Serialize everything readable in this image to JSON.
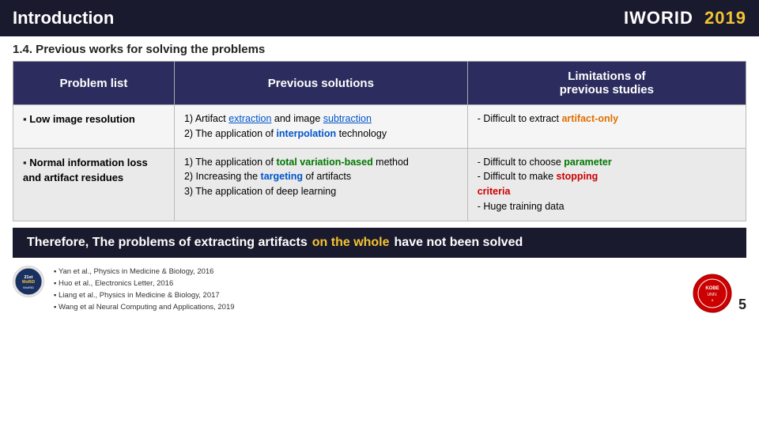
{
  "header": {
    "title": "Introduction",
    "logo_iworid": "IWORID",
    "logo_year": "2019"
  },
  "subtitle": "1.4. Previous works for solving the problems",
  "table": {
    "columns": [
      "Problem list",
      "Previous solutions",
      "Limitations of previous studies"
    ],
    "rows": [
      {
        "problem": "Low image resolution",
        "solutions": [
          {
            "num": "1)",
            "text_before": "Artifact ",
            "highlight": "extraction",
            "highlight_class": "underline-blue",
            "text_after": " and image "
          },
          {
            "continuation": "subtraction",
            "continuation_class": "underline-blue"
          },
          {
            "num": "2)",
            "text_before": "The application of ",
            "highlight": "interpolation",
            "highlight_class": "highlight-blue",
            "text_after": ""
          },
          {
            "continuation": "technology",
            "continuation_class": ""
          }
        ],
        "limitations": [
          {
            "text_before": "- Difficult to extract ",
            "highlight": "artifact-only",
            "highlight_class": "highlight-orange",
            "text_after": ""
          }
        ]
      },
      {
        "problem": "Normal information loss and artifact residues",
        "solutions": [
          {
            "num": "1)",
            "text_before": "The application of ",
            "highlight": "total variation-based",
            "highlight_class": "highlight-green",
            "text_after": ""
          },
          {
            "continuation": "method"
          },
          {
            "num": "2)",
            "text_before": "Increasing the ",
            "highlight": "targeting",
            "highlight_class": "highlight-blue",
            "text_after": " of artifacts"
          },
          {
            "num": "3)",
            "text_before": "The application of deep learning",
            "highlight": "",
            "text_after": ""
          }
        ],
        "limitations": [
          {
            "text_before": "- Difficult to choose ",
            "highlight": "parameter",
            "highlight_class": "highlight-green",
            "text_after": ""
          },
          {
            "text_before": "- Difficult to make ",
            "highlight": "stopping",
            "highlight_class": "highlight-red",
            "text_after": ""
          },
          {
            "continuation": "criteria",
            "continuation_class": "highlight-red"
          },
          {
            "text_before": "- Huge training data",
            "highlight": "",
            "text_after": ""
          }
        ]
      }
    ]
  },
  "banner": {
    "text_before": "Therefore, The problems of extracting artifacts ",
    "highlight": "on the whole",
    "text_after": " have not been solved"
  },
  "footer": {
    "refs": [
      "Yan et al., Physics in Medicine & Biology, 2016",
      "Huo et al., Electronics Letter, 2016",
      "Liang et al., Physics in Medicine & Biology, 2017",
      "Wang et al Neural Computing and Applications, 2019"
    ],
    "page_number": "5"
  }
}
